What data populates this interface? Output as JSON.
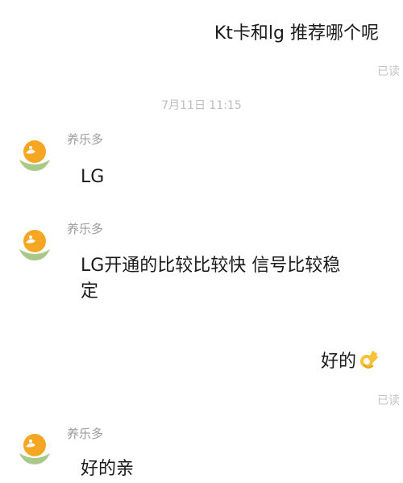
{
  "messages": [
    {
      "text": "Kt卡和lg 推荐哪个呢",
      "status": "已读"
    },
    {
      "timestamp": "7月11日 11:15"
    },
    {
      "sender": "养乐多",
      "text": "LG"
    },
    {
      "sender": "养乐多",
      "text_line1": "LG开通的比较比较快  信号比较稳",
      "text_line2": "定"
    },
    {
      "text": "好的",
      "emoji": "ok-hand-emoji",
      "status": "已读"
    },
    {
      "sender": "养乐多",
      "text": "好的亲"
    }
  ],
  "colors": {
    "status_gray": "#c4c4c4",
    "sender_gray": "#9b9b9b",
    "avatar_orange": "#f5a623",
    "avatar_green": "#a9c98a"
  }
}
